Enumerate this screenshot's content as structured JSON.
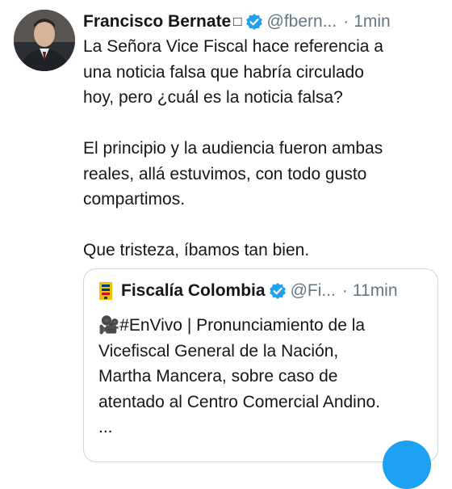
{
  "tweet": {
    "author_name": "Francisco Bernate",
    "name_glyph": "□",
    "handle": "@fbern...",
    "separator": "·",
    "time": "1min",
    "lines": [
      "La Señora Vice Fiscal hace referencia a",
      "una noticia falsa que habría circulado",
      "hoy, pero ¿cuál es la noticia falsa?",
      "",
      "El principio y la audiencia fueron ambas",
      "reales, allá estuvimos, con todo gusto",
      "compartimos.",
      "",
      "Que tristeza, íbamos tan bien."
    ]
  },
  "quote": {
    "author_name": "Fiscalía Colombia",
    "handle": "@Fi...",
    "separator": "·",
    "time": "11min",
    "lines": [
      "🎥#EnVivo | Pronunciamiento de la",
      "Vicefiscal General de la Nación,",
      "Martha Mancera, sobre caso de",
      "atentado al Centro Comercial Andino.",
      "..."
    ]
  },
  "icons": {
    "verified": "verified-badge-icon",
    "quote_logo": "fiscalia-logo-icon",
    "compose": "compose-button"
  },
  "colors": {
    "verified_blue": "#1da1f2",
    "secondary_text": "#657786",
    "card_border": "#ccd6dd"
  }
}
